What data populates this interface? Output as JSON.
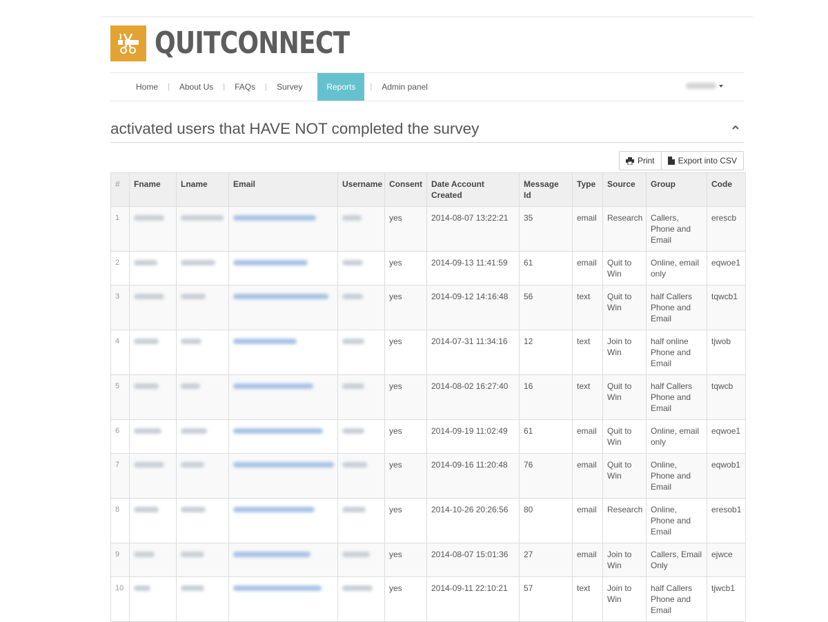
{
  "app": {
    "name": "QUITCONNECT",
    "brand_color": "#e3a332"
  },
  "nav": {
    "items": [
      "Home",
      "About Us",
      "FAQs",
      "Survey",
      "Reports",
      "Admin panel"
    ],
    "active": "Reports",
    "active_color": "#65c1ce"
  },
  "section": {
    "title": "activated users that HAVE NOT completed the survey"
  },
  "toolbar": {
    "print_label": "Print",
    "export_label": "Export into CSV"
  },
  "table": {
    "columns": [
      "#",
      "Fname",
      "Lname",
      "Email",
      "Username",
      "Consent",
      "Date Account Created",
      "Message Id",
      "Type",
      "Source",
      "Group",
      "Code"
    ],
    "rows": [
      {
        "n": "1",
        "consent": "yes",
        "created": "2014-08-07 13:22:21",
        "msg": "35",
        "type": "email",
        "source": "Research",
        "group": "Callers, Phone and Email",
        "code": "erescb"
      },
      {
        "n": "2",
        "consent": "yes",
        "created": "2014-09-13 11:41:59",
        "msg": "61",
        "type": "email",
        "source": "Quit to Win",
        "group": "Online, email only",
        "code": "eqwoe1"
      },
      {
        "n": "3",
        "consent": "yes",
        "created": "2014-09-12 14:16:48",
        "msg": "56",
        "type": "text",
        "source": "Quit to Win",
        "group": "half Callers Phone and Email",
        "code": "tqwcb1"
      },
      {
        "n": "4",
        "consent": "yes",
        "created": "2014-07-31 11:34:16",
        "msg": "12",
        "type": "text",
        "source": "Join to Win",
        "group": "half online Phone and Email",
        "code": "tjwob"
      },
      {
        "n": "5",
        "consent": "yes",
        "created": "2014-08-02 16:27:40",
        "msg": "16",
        "type": "text",
        "source": "Quit to Win",
        "group": "half Callers Phone and Email",
        "code": "tqwcb"
      },
      {
        "n": "6",
        "consent": "yes",
        "created": "2014-09-19 11:02:49",
        "msg": "61",
        "type": "email",
        "source": "Quit to Win",
        "group": "Online, email only",
        "code": "eqwoe1"
      },
      {
        "n": "7",
        "consent": "yes",
        "created": "2014-09-16 11:20:48",
        "msg": "76",
        "type": "email",
        "source": "Quit to Win",
        "group": "Online, Phone and Email",
        "code": "eqwob1"
      },
      {
        "n": "8",
        "consent": "yes",
        "created": "2014-10-26 20:26:56",
        "msg": "80",
        "type": "email",
        "source": "Research",
        "group": "Online, Phone and Email",
        "code": "eresob1"
      },
      {
        "n": "9",
        "consent": "yes",
        "created": "2014-08-07 15:01:36",
        "msg": "27",
        "type": "email",
        "source": "Join to Win",
        "group": "Callers, Email Only",
        "code": "ejwce"
      },
      {
        "n": "10",
        "consent": "yes",
        "created": "2014-09-11 22:10:21",
        "msg": "57",
        "type": "text",
        "source": "Join to Win",
        "group": "half Callers Phone and Email",
        "code": "tjwcb1"
      }
    ]
  }
}
